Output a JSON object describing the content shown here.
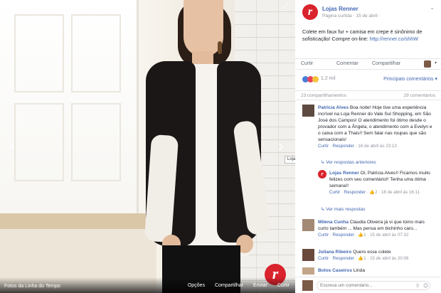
{
  "viewer": {
    "album": "Fotos da Linha do Tempo",
    "actions": [
      "Opções",
      "Compartilhar",
      "Enviar",
      "Curtir"
    ],
    "tag_label": "Lojas...",
    "prev_icon": "chevron-left-icon",
    "next_icon": "chevron-right-icon",
    "watermark": "r"
  },
  "post": {
    "logo_letter": "r",
    "page_name": "Lojas Renner",
    "meta": "Página curtida · 15 de abril ·",
    "text": "Colete em faux fur + camisa em crepe é sinônimo de sofisticação! Compre on-line:",
    "link": "http://renner.co/shhW",
    "actions": {
      "like": "Curtir",
      "comment": "Comentar",
      "share": "Compartilhar"
    },
    "reactions_count": "1,2 mil",
    "reactions_filter": "Principais comentários ▾",
    "shares": "23 compartilhamentos",
    "comments_count": "29 comentários"
  },
  "comments": [
    {
      "name": "Patricia Alves",
      "text": "Boa noite! Hoje tive uma experiência incrível na Loja Renner do Vale Sul Shopping, em São José dos Campos! O atendimento foi ótimo desde o provador com a Ângela, o atendimento com a Evelyn e o caixa com a Thais!! Sem falar nas roupas que são sensacionais!",
      "meta_like": "Curtir",
      "meta_reply": "Responder",
      "date": "16 de abril às 23:13",
      "replies": "Ver respostas anteriores"
    },
    {
      "name": "Lojas Renner",
      "text": "Oi, Patricia Alves!! Ficamos muito felizes com seu comentário!! Tenha uma ótima semana!!",
      "meta_like": "Curtir",
      "meta_reply": "Responder",
      "likes": "2",
      "date": "18 de abril às 16:11"
    },
    {
      "replies": "Ver mais respostas"
    },
    {
      "name": "Milena Cunha",
      "text": "Claudia Oliveira já vi que tomo mais curto também ... Mas pensa em bichinho caro... ",
      "meta_like": "Curtir",
      "meta_reply": "Responder",
      "likes": "1",
      "date": "15 de abril às 07:32"
    },
    {
      "name": "Juliana Ribeiro",
      "text": "Quero esse colete",
      "meta_like": "Curtir",
      "meta_reply": "Responder",
      "likes": "1",
      "date": "15 de abril às 20:06"
    },
    {
      "name": "Bolos Caseiros",
      "text": "Linda"
    }
  ],
  "compose": {
    "placeholder": "Escreva um comentário...",
    "camera_icon": "camera-icon",
    "emoji_icon": "emoji-icon"
  }
}
